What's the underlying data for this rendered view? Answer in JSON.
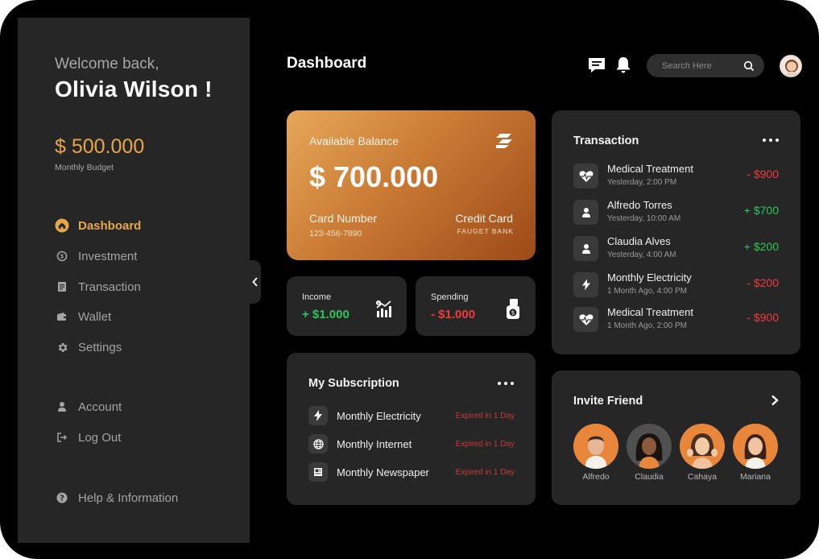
{
  "sidebar": {
    "welcome": "Welcome back,",
    "user_name": "Olivia Wilson !",
    "budget_value": "$ 500.000",
    "budget_label": "Monthly Budget",
    "nav": [
      {
        "label": "Dashboard",
        "icon": "home-icon",
        "active": true
      },
      {
        "label": "Investment",
        "icon": "investment-icon"
      },
      {
        "label": "Transaction",
        "icon": "document-icon"
      },
      {
        "label": "Wallet",
        "icon": "wallet-icon"
      },
      {
        "label": "Settings",
        "icon": "gear-icon"
      }
    ],
    "account": [
      {
        "label": "Account",
        "icon": "user-icon"
      },
      {
        "label": "Log Out",
        "icon": "logout-icon"
      }
    ],
    "help": {
      "label": "Help & Information",
      "icon": "help-icon"
    }
  },
  "header": {
    "title": "Dashboard",
    "search_placeholder": "Search Here"
  },
  "balance_card": {
    "label": "Available Balance",
    "value": "$ 700.000",
    "card_number_label": "Card Number",
    "card_number": "123-456-7890",
    "card_type": "Credit Card",
    "bank": "FAUGET BANK"
  },
  "income": {
    "label": "Income",
    "value": "+ $1.000"
  },
  "spending": {
    "label": "Spending",
    "value": "- $1.000"
  },
  "subscription": {
    "title": "My Subscription",
    "items": [
      {
        "name": "Monthly Electricity",
        "status": "Expired in 1 Day",
        "icon": "lightning-icon"
      },
      {
        "name": "Monthly Internet",
        "status": "Expired in 1 Day",
        "icon": "globe-icon"
      },
      {
        "name": "Monthly Newspaper",
        "status": "Expired in 1 Day",
        "icon": "newspaper-icon"
      }
    ]
  },
  "transactions": {
    "title": "Transaction",
    "items": [
      {
        "name": "Medical Treatment",
        "time": "Yesterday, 2:00 PM",
        "amount": "- $900",
        "type": "debit",
        "icon": "heart-pulse-icon"
      },
      {
        "name": "Alfredo Torres",
        "time": "Yesterday, 10:00 AM",
        "amount": "+ $700",
        "type": "credit",
        "icon": "user-icon"
      },
      {
        "name": "Claudia Alves",
        "time": "Yesterday, 4:00 AM",
        "amount": "+ $200",
        "type": "credit",
        "icon": "user-icon"
      },
      {
        "name": "Monthly Electricity",
        "time": "1 Month Ago, 4:00 PM",
        "amount": "- $200",
        "type": "debit",
        "icon": "lightning-icon"
      },
      {
        "name": "Medical Treatment",
        "time": "1 Month Ago, 2:00 PM",
        "amount": "- $900",
        "type": "debit",
        "icon": "heart-pulse-icon"
      }
    ]
  },
  "invite": {
    "title": "Invite Friend",
    "friends": [
      {
        "name": "Alfredo"
      },
      {
        "name": "Claudia"
      },
      {
        "name": "Cahaya"
      },
      {
        "name": "Mariana"
      }
    ]
  },
  "colors": {
    "accent": "#e9a649",
    "positive": "#2fc55a",
    "negative": "#ef3b3b",
    "panel": "#262626",
    "background": "#000000"
  }
}
